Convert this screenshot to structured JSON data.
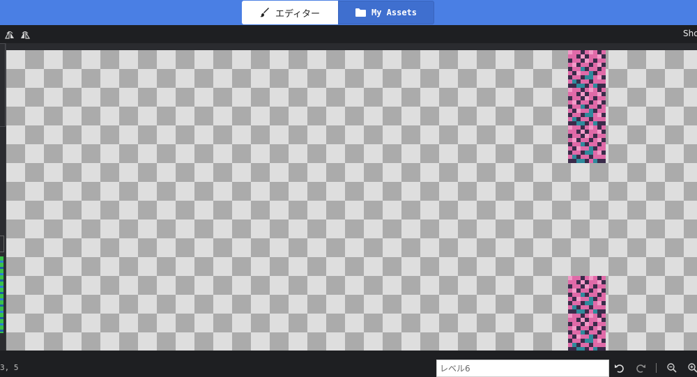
{
  "top_tabs": {
    "editor_label": "エディター",
    "assets_label": "My Assets",
    "editor_icon": "brush-icon",
    "assets_icon": "folder-icon"
  },
  "toolbar": {
    "show_label": "Sho",
    "icons": [
      "flip-horizontal-icon",
      "flip-vertical-icon"
    ]
  },
  "canvas": {
    "pattern": "transparency-checkerboard",
    "checker_colors": [
      "#dedede",
      "#ababab"
    ],
    "sprite_colors": [
      "#e06aa8",
      "#3a2b4a",
      "#2f8a9c",
      "#f29ac8"
    ]
  },
  "status": {
    "coordinates": "3, 5",
    "level_value": "",
    "level_placeholder": "レベル6",
    "icons": [
      "undo-icon",
      "redo-icon",
      "zoom-out-icon",
      "zoom-in-icon"
    ]
  },
  "colors": {
    "topbar": "#4a7fe4",
    "background": "#1e1f22"
  }
}
